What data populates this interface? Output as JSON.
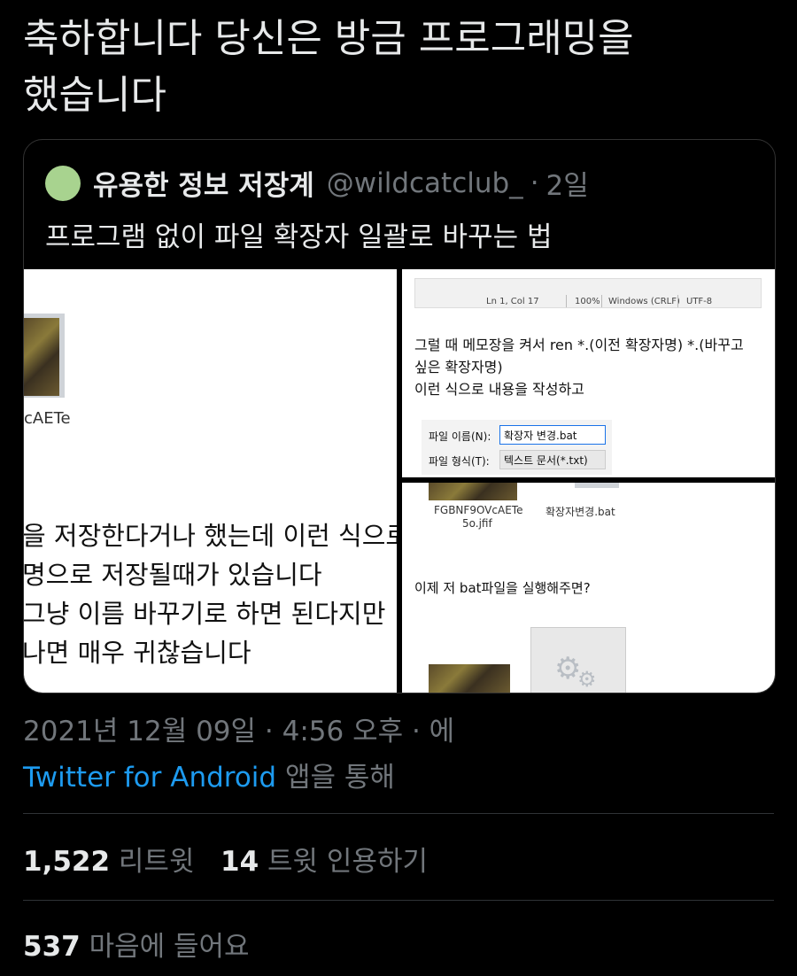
{
  "tweet": {
    "line1": "축하합니다 당신은 방금 프로그래밍을",
    "line2": "했습니다"
  },
  "quote": {
    "name": "유용한 정보 저장계",
    "handle": "@wildcatclub_",
    "dot": "·",
    "time": "2일",
    "text": "프로그램 없이 파일 확장자 일괄로 바꾸는 법",
    "avatar_color": "#a8d38f"
  },
  "image1": {
    "caption": "cAETe",
    "lines": [
      "을 저장한다거나 했는데 이런 식으로",
      "명으로 저장될때가 있습니다",
      "그냥 이름 바꾸기로 하면 된다지만",
      "나면 매우 귀찮습니다"
    ]
  },
  "image2": {
    "status": {
      "position": "Ln 1, Col 17",
      "zoom": "100%",
      "eol": "Windows (CRLF)",
      "encoding": "UTF-8"
    },
    "lines": [
      "그럴 때 메모장을 켜서 ren *.(이전 확장자명) *.(바꾸고",
      "싶은 확장자명)",
      "이런 식으로 내용을 작성하고"
    ],
    "dialog": {
      "filename_label": "파일 이름(N):",
      "filename_value": "확장자 변경.bat",
      "filetype_label": "파일 형식(T):",
      "filetype_value": "텍스트 문서(*.txt)"
    }
  },
  "image3": {
    "file1_line1": "FGBNF9OVcAETe",
    "file1_line2": "5o.jfif",
    "file2": "확장자변경.bat",
    "message": "이제 저 bat파일을 실행해주면?"
  },
  "meta": {
    "date": "2021년 12월 09일 · 4:56 오후 · 에",
    "source_app": "Twitter for Android",
    "source_suffix": " 앱을 통해"
  },
  "stats": {
    "retweets": "1,522",
    "retweets_label": " 리트윗",
    "quotes": "14",
    "quotes_label": " 트윗 인용하기",
    "likes": "537",
    "likes_label": " 마음에 들어요"
  },
  "colors": {
    "background": "#000000",
    "text": "#e7e9ea",
    "muted": "#71767b",
    "link": "#1d9bf0"
  }
}
